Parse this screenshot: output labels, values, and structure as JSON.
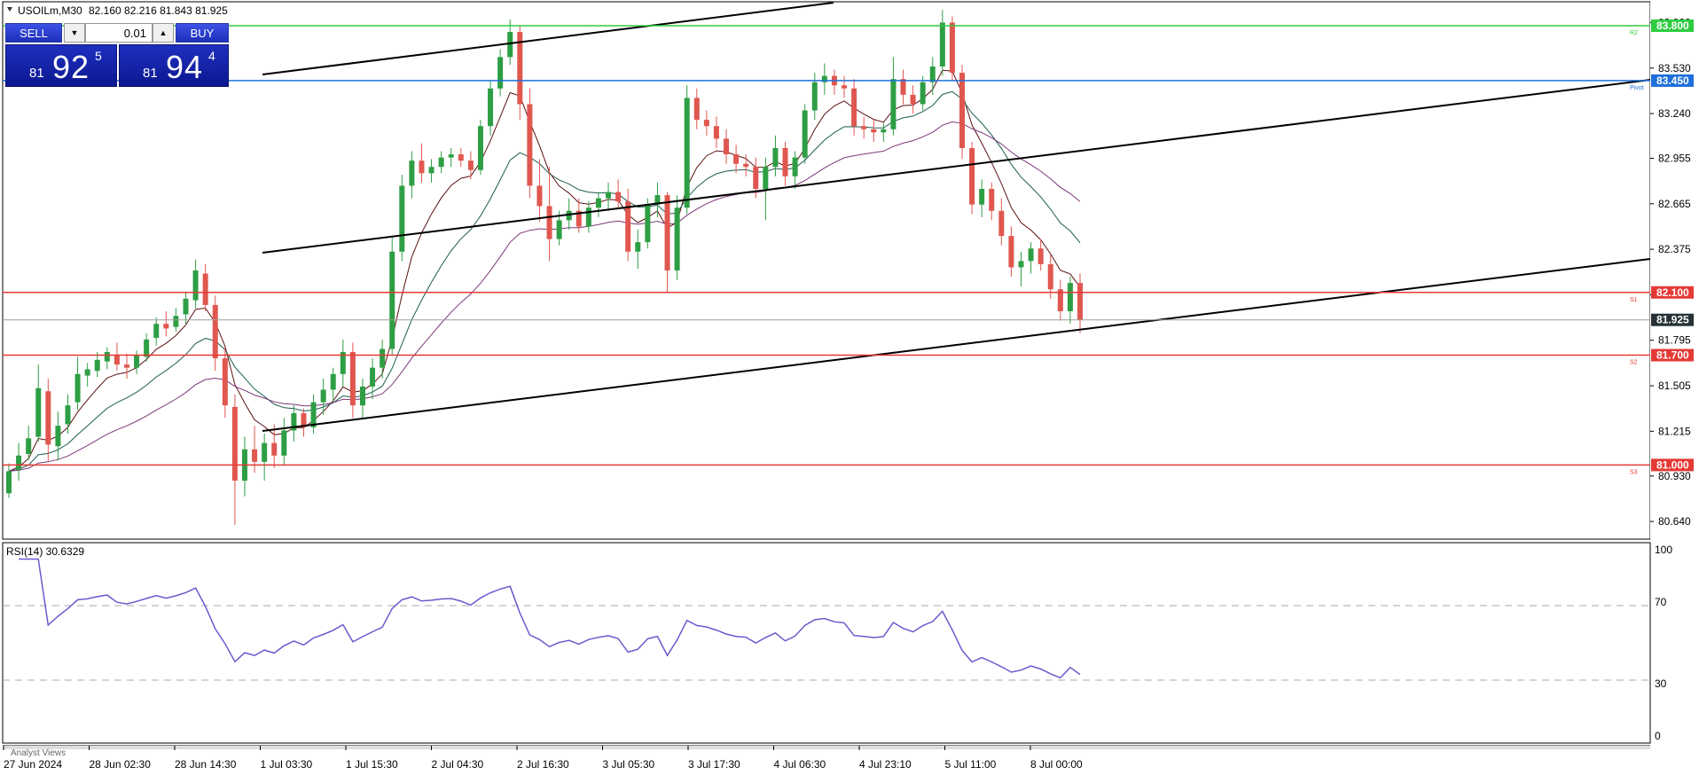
{
  "header": {
    "symbol_timeframe": "USOILm,M30",
    "ohlc": "82.160 82.216 81.843 81.925"
  },
  "trade_panel": {
    "sell_label": "SELL",
    "buy_label": "BUY",
    "lot_value": "0.01",
    "sell_price": {
      "small": "81",
      "big": "92",
      "sup": "5"
    },
    "buy_price": {
      "small": "81",
      "big": "94",
      "sup": "4"
    }
  },
  "price_axis": {
    "ticks": [
      "83.820",
      "83.530",
      "83.240",
      "82.955",
      "82.665",
      "82.375",
      "82.085",
      "81.795",
      "81.505",
      "81.215",
      "80.930",
      "80.640"
    ]
  },
  "levels": [
    {
      "name": "R2",
      "value": 83.8,
      "label": "83.800",
      "color": "#2ecc40"
    },
    {
      "name": "Pivot",
      "value": 83.45,
      "label": "83.450",
      "color": "#1e6fd9"
    },
    {
      "name": "S1",
      "value": 82.1,
      "label": "82.100",
      "color": "#e53935"
    },
    {
      "name": "S2",
      "value": 81.7,
      "label": "81.700",
      "color": "#e53935"
    },
    {
      "name": "S3",
      "value": 81.0,
      "label": "81.000",
      "color": "#e53935"
    }
  ],
  "current_price": {
    "value": 81.925,
    "label": "81.925",
    "color": "#263238"
  },
  "rsi": {
    "label": "RSI(14) 30.6329",
    "axis": [
      "100",
      "70",
      "30",
      "0"
    ],
    "levels": [
      70,
      30
    ]
  },
  "time_axis": {
    "ticks": [
      "27 Jun 2024",
      "28 Jun 02:30",
      "28 Jun 14:30",
      "1 Jul 03:30",
      "1 Jul 15:30",
      "2 Jul 04:30",
      "2 Jul 16:30",
      "3 Jul 05:30",
      "3 Jul 17:30",
      "4 Jul 06:30",
      "4 Jul 23:10",
      "5 Jul 11:00",
      "8 Jul 00:00"
    ]
  },
  "bottom_tab": "Analyst Views",
  "colors": {
    "bull": "#2e9e44",
    "bear": "#e0574f",
    "ma_fast": "#5d1010",
    "ma_mid": "#1d5c52",
    "ma_slow": "#7b3a7a",
    "rsi": "#6a5acd"
  },
  "chart_data": {
    "type": "candlestick",
    "ylim": [
      80.55,
      83.93
    ],
    "candles": [
      [
        80.82,
        81.01,
        80.79,
        80.96
      ],
      [
        80.97,
        81.14,
        80.9,
        81.06
      ],
      [
        81.07,
        81.25,
        81.03,
        81.17
      ],
      [
        81.18,
        81.64,
        81.15,
        81.49
      ],
      [
        81.47,
        81.55,
        81.02,
        81.13
      ],
      [
        81.12,
        81.34,
        81.03,
        81.25
      ],
      [
        81.26,
        81.45,
        81.2,
        81.38
      ],
      [
        81.4,
        81.69,
        81.35,
        81.58
      ],
      [
        81.57,
        81.65,
        81.5,
        81.61
      ],
      [
        81.6,
        81.72,
        81.56,
        81.67
      ],
      [
        81.66,
        81.75,
        81.61,
        81.72
      ],
      [
        81.7,
        81.78,
        81.6,
        81.64
      ],
      [
        81.64,
        81.71,
        81.55,
        81.62
      ],
      [
        81.62,
        81.73,
        81.58,
        81.7
      ],
      [
        81.69,
        81.84,
        81.66,
        81.8
      ],
      [
        81.81,
        81.94,
        81.76,
        81.9
      ],
      [
        81.9,
        81.98,
        81.82,
        81.87
      ],
      [
        81.88,
        82.0,
        81.85,
        81.95
      ],
      [
        81.96,
        82.1,
        81.9,
        82.06
      ],
      [
        82.05,
        82.31,
        82.0,
        82.24
      ],
      [
        82.22,
        82.28,
        81.98,
        82.02
      ],
      [
        82.02,
        82.08,
        81.6,
        81.68
      ],
      [
        81.68,
        81.75,
        81.3,
        81.38
      ],
      [
        81.37,
        81.45,
        80.62,
        80.9
      ],
      [
        80.9,
        81.18,
        80.8,
        81.1
      ],
      [
        81.1,
        81.25,
        80.95,
        81.02
      ],
      [
        81.02,
        81.2,
        80.9,
        81.14
      ],
      [
        81.14,
        81.26,
        80.98,
        81.06
      ],
      [
        81.06,
        81.3,
        81.0,
        81.22
      ],
      [
        81.22,
        81.38,
        81.15,
        81.33
      ],
      [
        81.33,
        81.36,
        81.18,
        81.24
      ],
      [
        81.24,
        81.45,
        81.2,
        81.4
      ],
      [
        81.4,
        81.55,
        81.32,
        81.48
      ],
      [
        81.48,
        81.62,
        81.4,
        81.58
      ],
      [
        81.58,
        81.8,
        81.5,
        81.72
      ],
      [
        81.72,
        81.78,
        81.3,
        81.38
      ],
      [
        81.38,
        81.55,
        81.3,
        81.5
      ],
      [
        81.5,
        81.68,
        81.42,
        81.62
      ],
      [
        81.62,
        81.8,
        81.55,
        81.74
      ],
      [
        81.74,
        82.45,
        81.7,
        82.36
      ],
      [
        82.36,
        82.85,
        82.3,
        82.78
      ],
      [
        82.78,
        83.0,
        82.7,
        82.94
      ],
      [
        82.94,
        83.05,
        82.8,
        82.86
      ],
      [
        82.86,
        82.95,
        82.8,
        82.9
      ],
      [
        82.9,
        83.0,
        82.86,
        82.96
      ],
      [
        82.96,
        83.02,
        82.9,
        82.98
      ],
      [
        82.98,
        83.02,
        82.9,
        82.94
      ],
      [
        82.94,
        83.0,
        82.82,
        82.88
      ],
      [
        82.88,
        83.2,
        82.85,
        83.16
      ],
      [
        83.16,
        83.45,
        83.1,
        83.4
      ],
      [
        83.4,
        83.65,
        83.35,
        83.6
      ],
      [
        83.6,
        83.84,
        83.55,
        83.76
      ],
      [
        83.76,
        83.8,
        83.2,
        83.3
      ],
      [
        83.3,
        83.4,
        82.7,
        82.78
      ],
      [
        82.78,
        82.95,
        82.55,
        82.65
      ],
      [
        82.65,
        82.9,
        82.3,
        82.44
      ],
      [
        82.44,
        82.62,
        82.4,
        82.56
      ],
      [
        82.56,
        82.7,
        82.5,
        82.62
      ],
      [
        82.62,
        82.7,
        82.48,
        82.52
      ],
      [
        82.52,
        82.68,
        82.48,
        82.64
      ],
      [
        82.64,
        82.74,
        82.58,
        82.7
      ],
      [
        82.7,
        82.8,
        82.62,
        82.74
      ],
      [
        82.74,
        82.82,
        82.64,
        82.68
      ],
      [
        82.68,
        82.76,
        82.3,
        82.36
      ],
      [
        82.36,
        82.5,
        82.25,
        82.42
      ],
      [
        82.42,
        82.7,
        82.38,
        82.66
      ],
      [
        82.66,
        82.8,
        82.58,
        82.72
      ],
      [
        82.72,
        82.74,
        82.1,
        82.24
      ],
      [
        82.24,
        82.72,
        82.18,
        82.64
      ],
      [
        82.64,
        83.42,
        82.6,
        83.34
      ],
      [
        83.34,
        83.4,
        83.14,
        83.2
      ],
      [
        83.2,
        83.26,
        83.1,
        83.16
      ],
      [
        83.16,
        83.22,
        83.02,
        83.08
      ],
      [
        83.08,
        83.14,
        82.92,
        82.98
      ],
      [
        82.98,
        83.04,
        82.86,
        82.92
      ],
      [
        82.92,
        82.98,
        82.84,
        82.9
      ],
      [
        82.9,
        82.96,
        82.7,
        82.76
      ],
      [
        82.76,
        82.96,
        82.56,
        82.9
      ],
      [
        82.9,
        83.1,
        82.84,
        83.02
      ],
      [
        83.02,
        83.06,
        82.78,
        82.84
      ],
      [
        82.84,
        83.0,
        82.76,
        82.96
      ],
      [
        82.96,
        83.3,
        82.92,
        83.26
      ],
      [
        83.26,
        83.5,
        83.2,
        83.44
      ],
      [
        83.44,
        83.56,
        83.36,
        83.48
      ],
      [
        83.48,
        83.52,
        83.36,
        83.42
      ],
      [
        83.42,
        83.48,
        83.34,
        83.4
      ],
      [
        83.4,
        83.46,
        83.1,
        83.16
      ],
      [
        83.16,
        83.22,
        83.08,
        83.14
      ],
      [
        83.14,
        83.2,
        83.06,
        83.12
      ],
      [
        83.12,
        83.18,
        83.06,
        83.14
      ],
      [
        83.14,
        83.6,
        83.1,
        83.46
      ],
      [
        83.46,
        83.52,
        83.3,
        83.36
      ],
      [
        83.36,
        83.42,
        83.24,
        83.3
      ],
      [
        83.3,
        83.48,
        83.26,
        83.44
      ],
      [
        83.44,
        83.6,
        83.36,
        83.54
      ],
      [
        83.54,
        83.9,
        83.48,
        83.82
      ],
      [
        83.82,
        83.86,
        83.45,
        83.5
      ],
      [
        83.5,
        83.55,
        82.95,
        83.02
      ],
      [
        83.02,
        83.06,
        82.6,
        82.66
      ],
      [
        82.66,
        82.82,
        82.58,
        82.76
      ],
      [
        82.76,
        82.8,
        82.56,
        82.62
      ],
      [
        82.62,
        82.7,
        82.4,
        82.46
      ],
      [
        82.46,
        82.52,
        82.2,
        82.26
      ],
      [
        82.26,
        82.36,
        82.14,
        82.3
      ],
      [
        82.3,
        82.42,
        82.22,
        82.38
      ],
      [
        82.38,
        82.44,
        82.24,
        82.28
      ],
      [
        82.28,
        82.34,
        82.06,
        82.12
      ],
      [
        82.12,
        82.18,
        81.92,
        81.98
      ],
      [
        81.98,
        82.2,
        81.9,
        82.16
      ],
      [
        82.16,
        82.22,
        81.84,
        81.925
      ]
    ]
  }
}
